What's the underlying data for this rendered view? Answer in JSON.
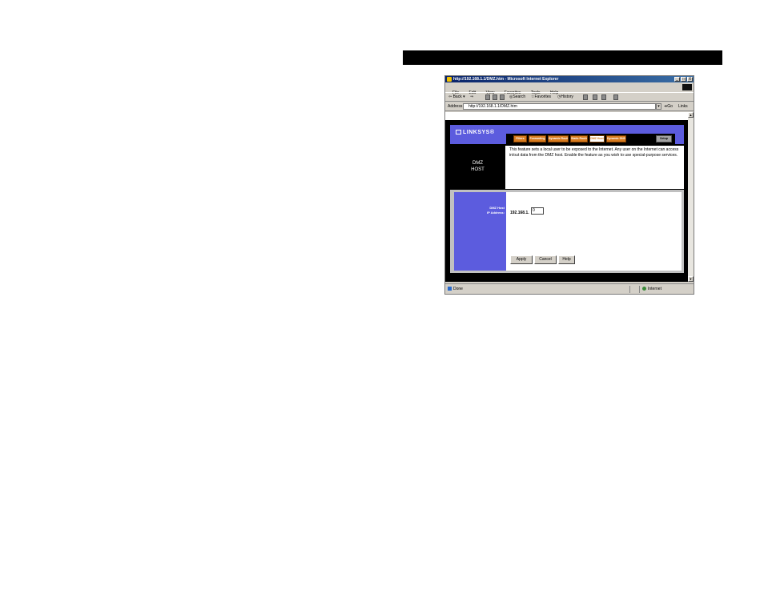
{
  "browser": {
    "title": "http://192.168.1.1/DMZ.htm - Microsoft Internet Explorer",
    "window_buttons": [
      "_",
      "□",
      "X"
    ],
    "menu": [
      "File",
      "Edit",
      "View",
      "Favorites",
      "Tools",
      "Help"
    ],
    "toolbar": {
      "back": "Back",
      "forward": "⇒",
      "search": "Search",
      "favorites": "Favorites",
      "history": "History"
    },
    "address_label": "Address",
    "address_value": "http://192.168.1.1/DMZ.htm",
    "go_label": "Go",
    "links_label": "Links"
  },
  "router": {
    "logo": "LINKSYS",
    "tabs": [
      "Filters",
      "Forwarding",
      "Dynamic Routing",
      "Static Routing",
      "DMZ Host",
      "Dynamic DNS",
      "Setup"
    ],
    "active_tab": "DMZ Host",
    "section_title_line1": "DMZ",
    "section_title_line2": "HOST",
    "description": "This feature sets a local user to be exposed to the Internet. Any user on the Internet can access in/out data from the DMZ host. Enable the feature as you wish to use special-purpose services.",
    "form": {
      "label_line1": "DMZ Host",
      "label_line2": "IP Address:",
      "ip_prefix": "192.168.1.",
      "ip_value": "0"
    },
    "buttons": {
      "apply": "Apply",
      "cancel": "Cancel",
      "help": "Help"
    }
  },
  "status": {
    "left": "Done",
    "right": "Internet"
  },
  "colors": {
    "banner_blue": "#5c5cde",
    "tab_orange": "#d67a1e",
    "titlebar": "#0a246a"
  }
}
